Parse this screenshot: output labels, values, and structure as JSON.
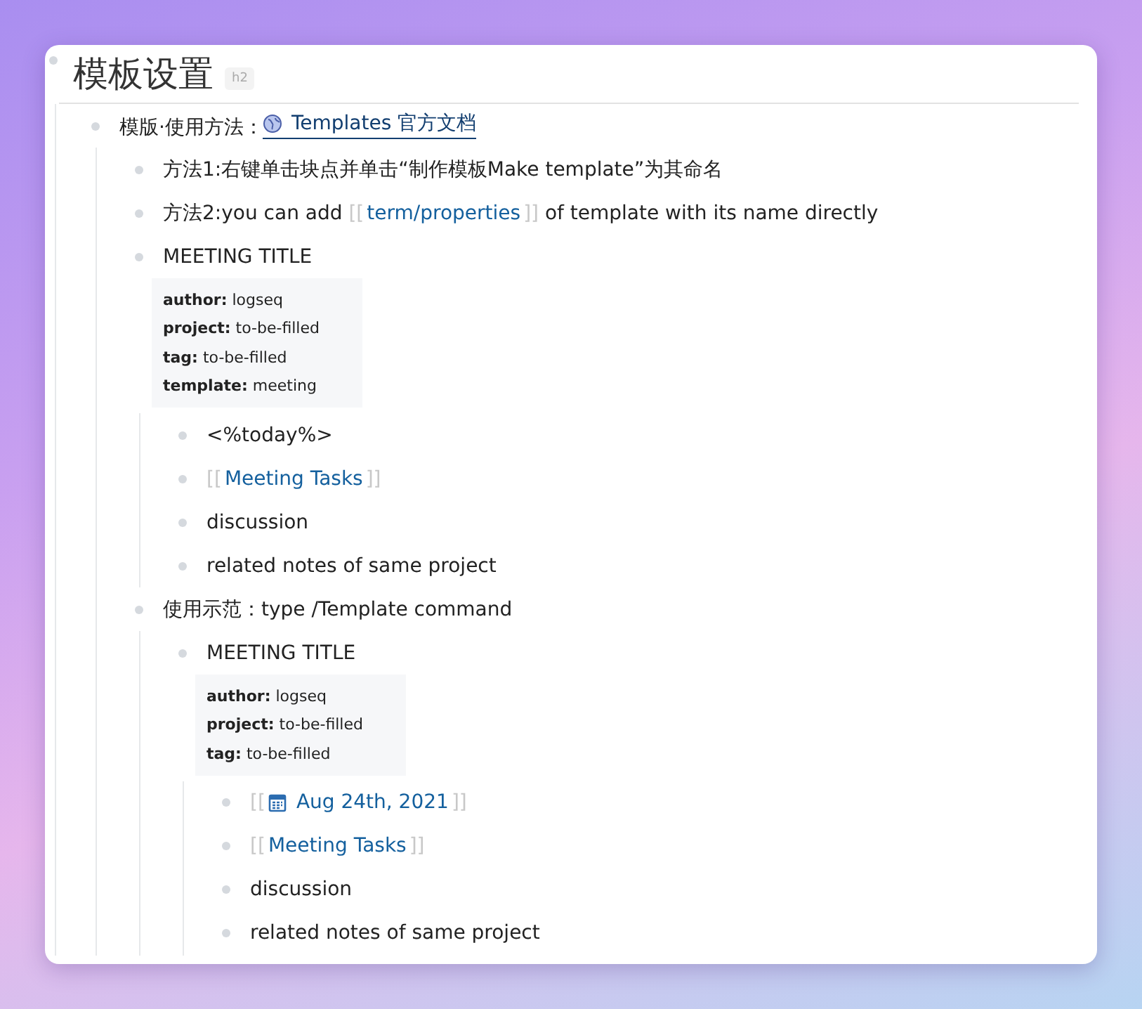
{
  "heading": {
    "title": "模板设置",
    "tag": "h2"
  },
  "blocks": [
    {
      "segments": [
        {
          "kind": "text",
          "text": "模版·使用方法："
        },
        {
          "kind": "web-link",
          "text": "Templates 官方文档"
        }
      ],
      "children": [
        {
          "segments": [
            {
              "kind": "text",
              "text": "方法1:右键单击块点并单击“制作模板Make template”为其命名"
            }
          ]
        },
        {
          "segments": [
            {
              "kind": "text",
              "text": "方法2:you can add "
            },
            {
              "kind": "page-ref",
              "open": "[[",
              "text": "term/properties",
              "close": "]]"
            },
            {
              "kind": "text",
              "text": " of template with its name directly"
            }
          ]
        },
        {
          "segments": [
            {
              "kind": "text",
              "text": "MEETING TITLE"
            }
          ],
          "properties": [
            {
              "key": "author:",
              "value": "logseq"
            },
            {
              "key": "project:",
              "value": "to-be-filled"
            },
            {
              "key": "tag:",
              "value": "to-be-filled"
            },
            {
              "key": "template:",
              "value": "meeting"
            }
          ],
          "children": [
            {
              "segments": [
                {
                  "kind": "text",
                  "text": "<%today%>"
                }
              ]
            },
            {
              "segments": [
                {
                  "kind": "page-ref",
                  "open": "[[",
                  "text": "Meeting Tasks",
                  "close": "]]"
                }
              ]
            },
            {
              "segments": [
                {
                  "kind": "text",
                  "text": "discussion"
                }
              ]
            },
            {
              "segments": [
                {
                  "kind": "text",
                  "text": "related notes of same project"
                }
              ]
            }
          ]
        },
        {
          "segments": [
            {
              "kind": "text",
              "text": "使用示范：type /Template command"
            }
          ],
          "children": [
            {
              "segments": [
                {
                  "kind": "text",
                  "text": "MEETING TITLE"
                }
              ],
              "properties": [
                {
                  "key": "author:",
                  "value": "logseq"
                },
                {
                  "key": "project:",
                  "value": "to-be-filled"
                },
                {
                  "key": "tag:",
                  "value": "to-be-filled"
                }
              ],
              "children": [
                {
                  "segments": [
                    {
                      "kind": "date-ref",
                      "open": "[[",
                      "text": "Aug 24th, 2021",
                      "close": "]]"
                    }
                  ]
                },
                {
                  "segments": [
                    {
                      "kind": "page-ref",
                      "open": "[[",
                      "text": "Meeting Tasks",
                      "close": "]]"
                    }
                  ]
                },
                {
                  "segments": [
                    {
                      "kind": "text",
                      "text": "discussion"
                    }
                  ]
                },
                {
                  "segments": [
                    {
                      "kind": "text",
                      "text": "related notes of same project"
                    }
                  ]
                }
              ]
            }
          ]
        }
      ]
    }
  ]
}
